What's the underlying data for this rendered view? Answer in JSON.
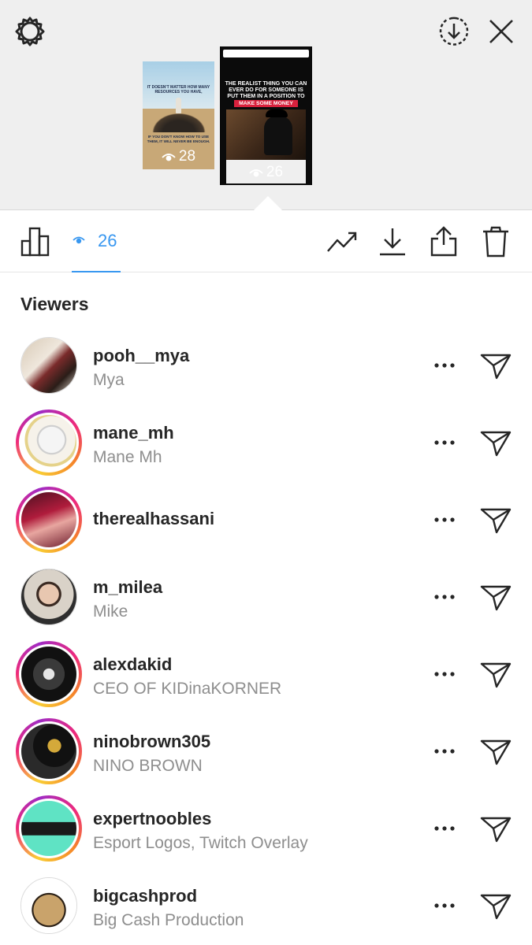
{
  "preview": {
    "story1": {
      "headline": "IT DOESN'T MATTER HOW MANY RESOURCES YOU HAVE,",
      "footer": "IF YOU DON'T KNOW HOW TO USE THEM, IT WILL NEVER BE ENOUGH.",
      "views": "28"
    },
    "story2": {
      "title": "THE REALIST THING YOU CAN EVER DO FOR SOMEONE IS PUT THEM IN A POSITION TO",
      "highlight": "MAKE SOME MONEY",
      "views": "26"
    }
  },
  "toolbar": {
    "views_count": "26",
    "icons": [
      "stats-icon",
      "eye-icon",
      "trend-icon",
      "save-icon",
      "share-icon",
      "trash-icon"
    ]
  },
  "viewers": {
    "title": "Viewers",
    "items": [
      {
        "username": "pooh__mya",
        "fullname": "Mya",
        "ring": false
      },
      {
        "username": "mane_mh",
        "fullname": "Mane Mh",
        "ring": true
      },
      {
        "username": "therealhassani",
        "fullname": "",
        "ring": true
      },
      {
        "username": "m_milea",
        "fullname": "Mike",
        "ring": false
      },
      {
        "username": "alexdakid",
        "fullname": "CEO OF KIDinaKORNER",
        "ring": true
      },
      {
        "username": "ninobrown305",
        "fullname": "NINO BROWN",
        "ring": true
      },
      {
        "username": "expertnoobles",
        "fullname": "Esport Logos, Twitch Overlay",
        "ring": true
      },
      {
        "username": "bigcashprod",
        "fullname": "Big Cash Production",
        "ring": false
      }
    ]
  },
  "colors": {
    "accent": "#3897f0",
    "text": "#262626",
    "secondary": "#8e8e8e",
    "preview_bg": "#efefef"
  }
}
